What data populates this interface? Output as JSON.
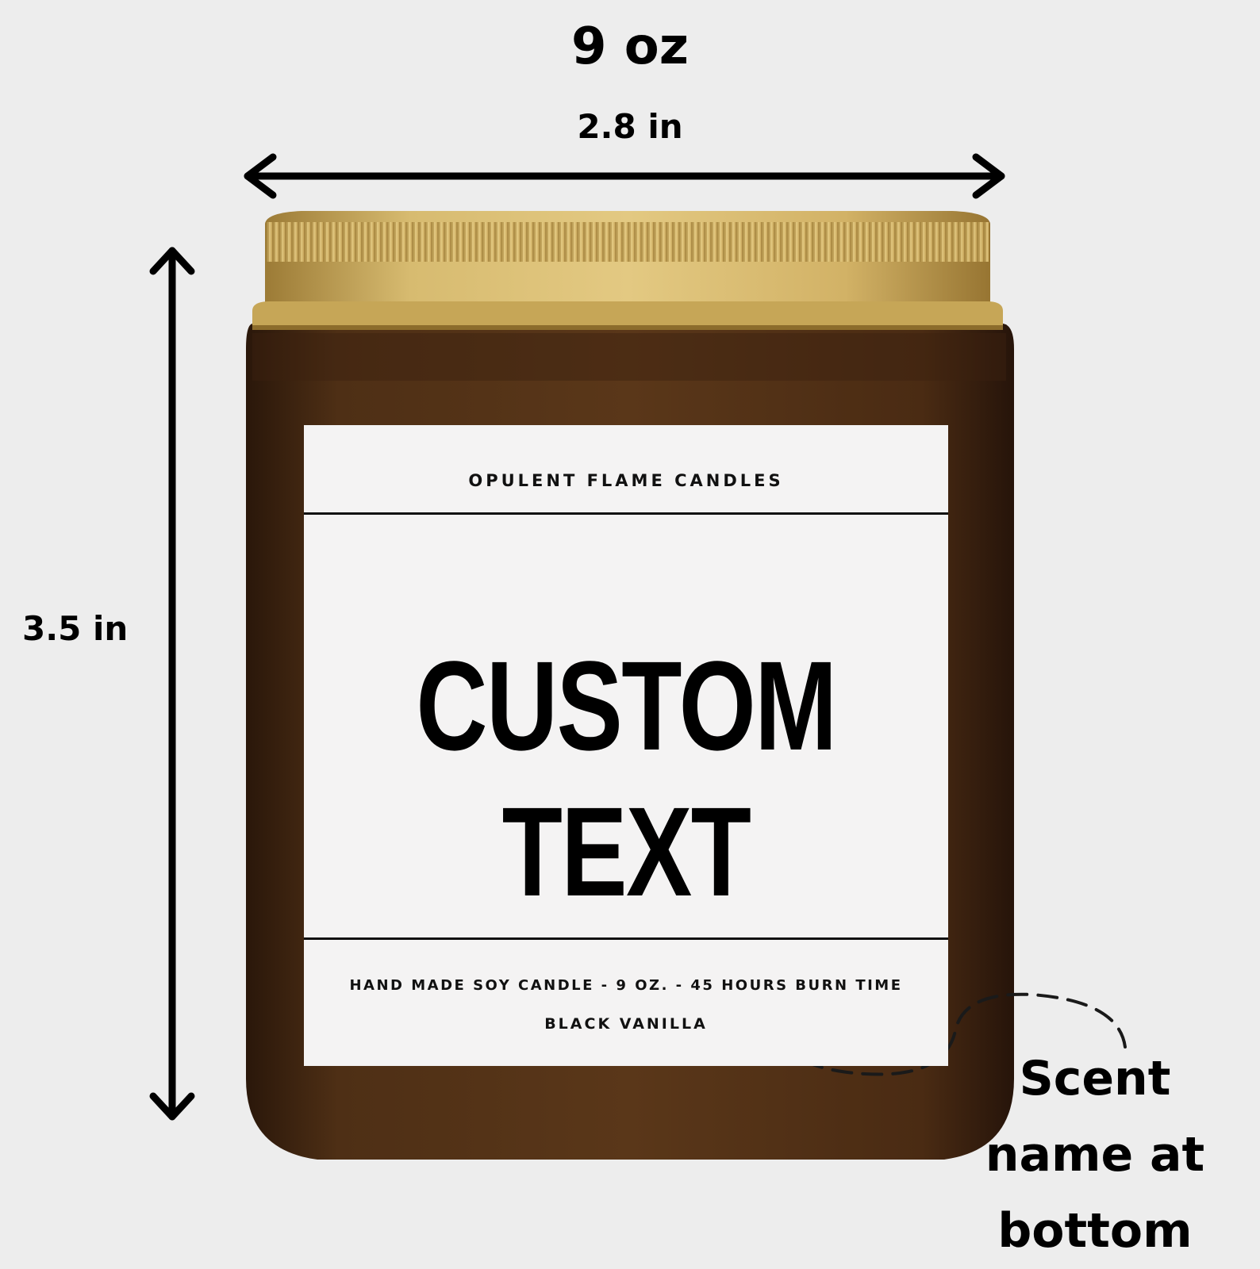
{
  "dimensions": {
    "volume": "9 oz",
    "width": "2.8 in",
    "height": "3.5 in"
  },
  "label": {
    "brand": "OPULENT FLAME CANDLES",
    "custom_text": "CUSTOM TEXT",
    "info_line": "HAND MADE SOY CANDLE - 9 OZ. - 45 HOURS BURN TIME",
    "scent": "BLACK VANILLA"
  },
  "callout": {
    "text": "Scent name at bottom"
  },
  "colors": {
    "background": "#ededed",
    "jar_amber": "#4a2c14",
    "lid_gold": "#c9a95a",
    "label": "#f4f3f3"
  },
  "icons": [
    "double-arrow-horizontal-icon",
    "double-arrow-vertical-icon",
    "dashed-curved-arrow-icon"
  ]
}
